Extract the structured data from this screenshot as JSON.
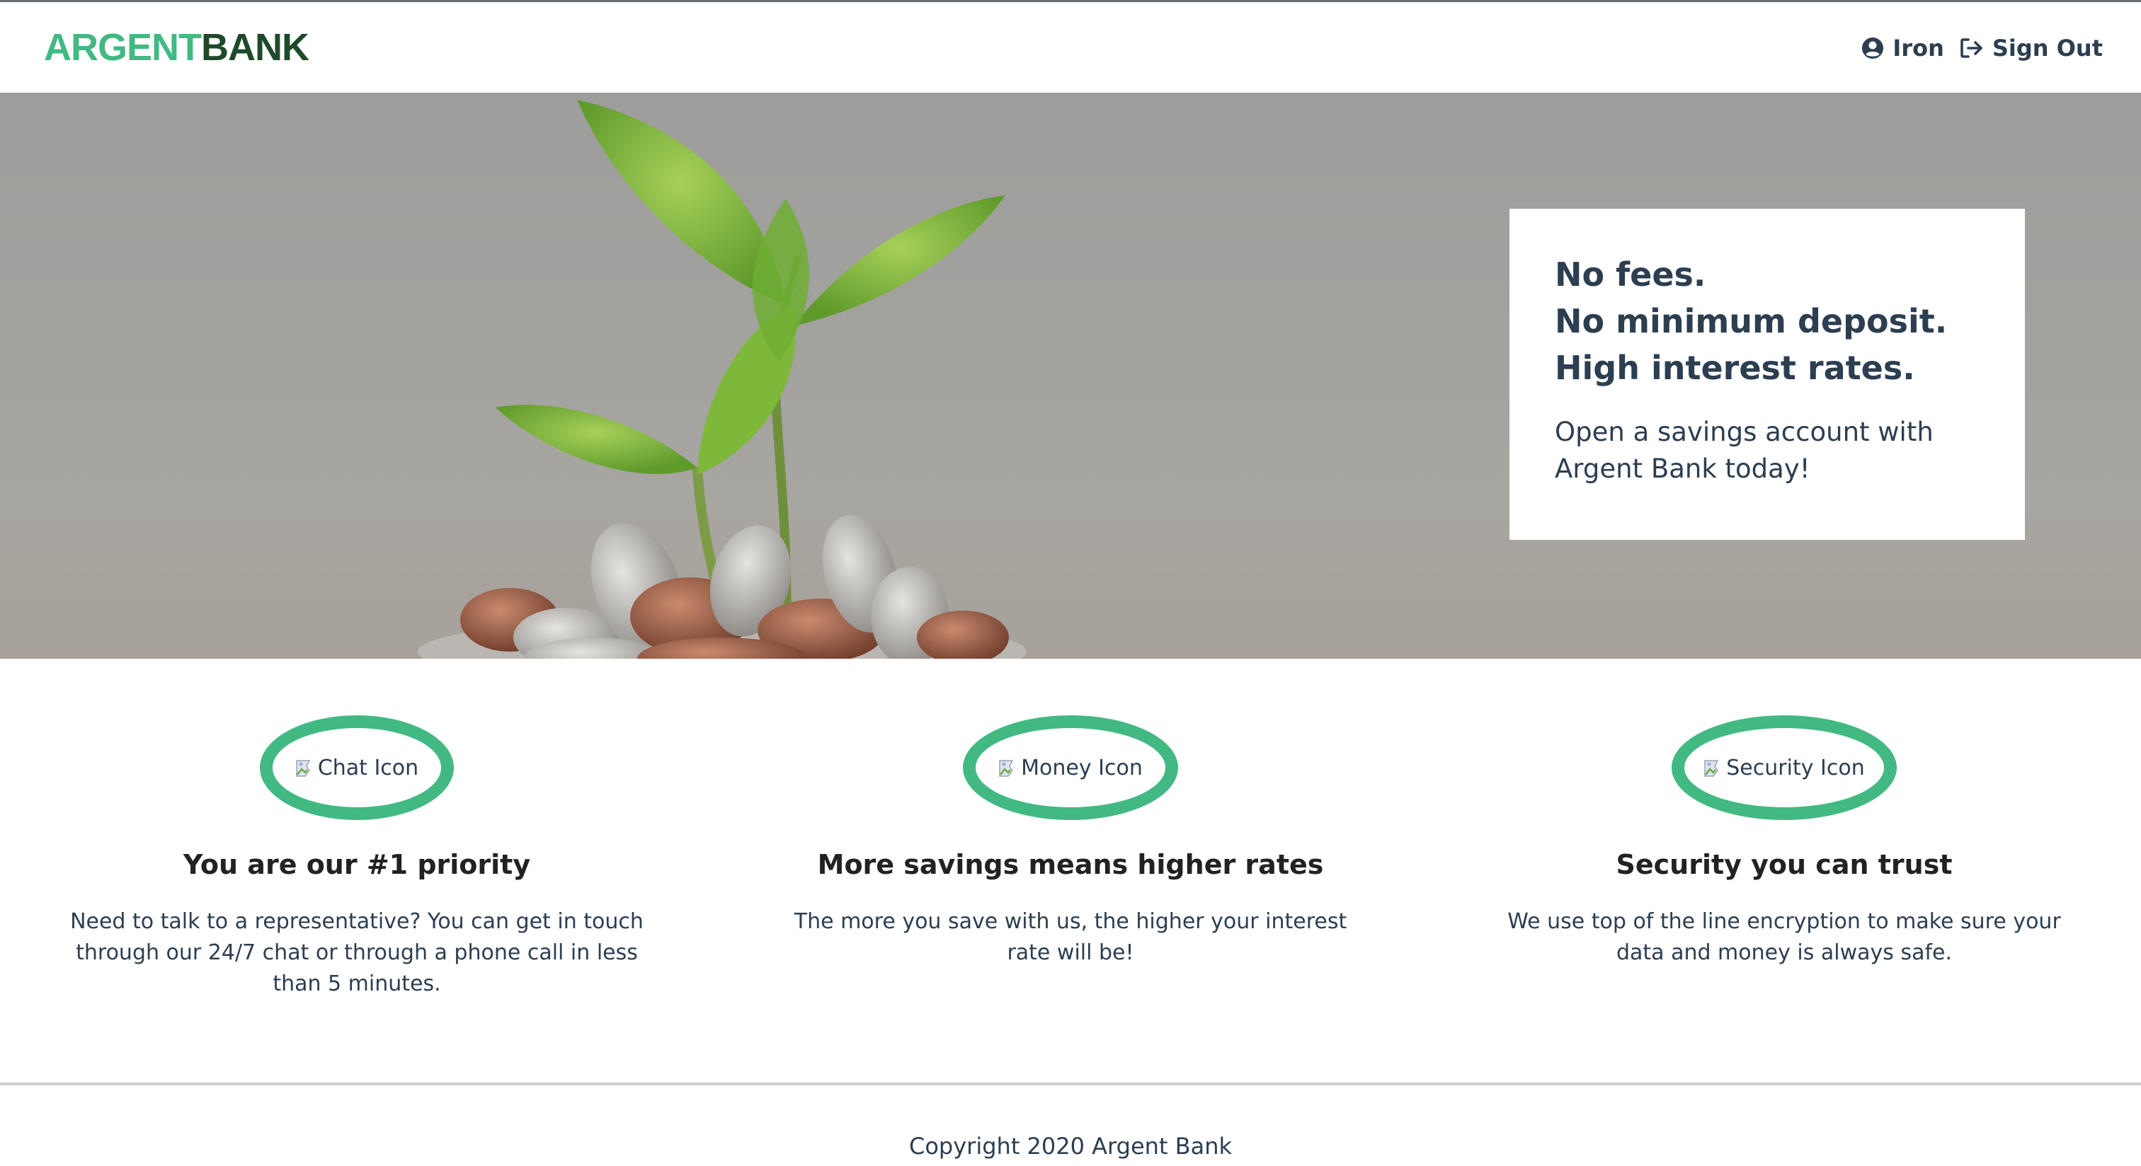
{
  "brand": {
    "name_part1": "ARGENT",
    "name_part2": "BANK",
    "primary_color": "#42b983",
    "secondary_color": "#1f4a2a"
  },
  "nav": {
    "user_label": "Iron",
    "user_icon": "user-circle-icon",
    "signout_label": "Sign Out",
    "signout_icon": "sign-out-icon"
  },
  "hero": {
    "subtitles": [
      "No fees.",
      "No minimum deposit.",
      "High interest rates."
    ],
    "text_line1": "Open a savings account with",
    "text_line2": "Argent Bank today!"
  },
  "features": [
    {
      "icon_alt": "Chat Icon",
      "title": "You are our #1 priority",
      "text": "Need to talk to a representative? You can get in touch through our 24/7 chat or through a phone call in less than 5 minutes."
    },
    {
      "icon_alt": "Money Icon",
      "title": "More savings means higher rates",
      "text": "The more you save with us, the higher your interest rate will be!"
    },
    {
      "icon_alt": "Security Icon",
      "title": "Security you can trust",
      "text": "We use top of the line encryption to make sure your data and money is always safe."
    }
  ],
  "footer": {
    "copyright": "Copyright 2020 Argent Bank"
  }
}
